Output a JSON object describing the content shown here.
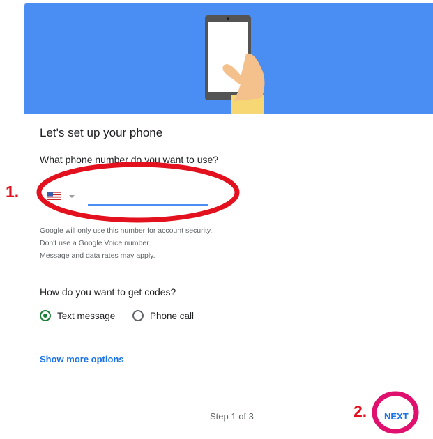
{
  "hero": {
    "icon": "phone-in-hand-illustration",
    "background": "#4a8ef3"
  },
  "title": "Let's set up your phone",
  "phone_question": "What phone number do you want to use?",
  "phone_input": {
    "value": "",
    "country_flag": "us-flag-icon"
  },
  "notes": [
    "Google will only use this number for account security.",
    "Don't use a Google Voice number.",
    "Message and data rates may apply."
  ],
  "codes_question": "How do you want to get codes?",
  "code_options": [
    {
      "label": "Text message",
      "selected": true
    },
    {
      "label": "Phone call",
      "selected": false
    }
  ],
  "show_more": "Show more options",
  "step_text": "Step 1 of 3",
  "next_label": "NEXT",
  "annotations": {
    "one": "1.",
    "two": "2.",
    "color": "#e3101e"
  }
}
